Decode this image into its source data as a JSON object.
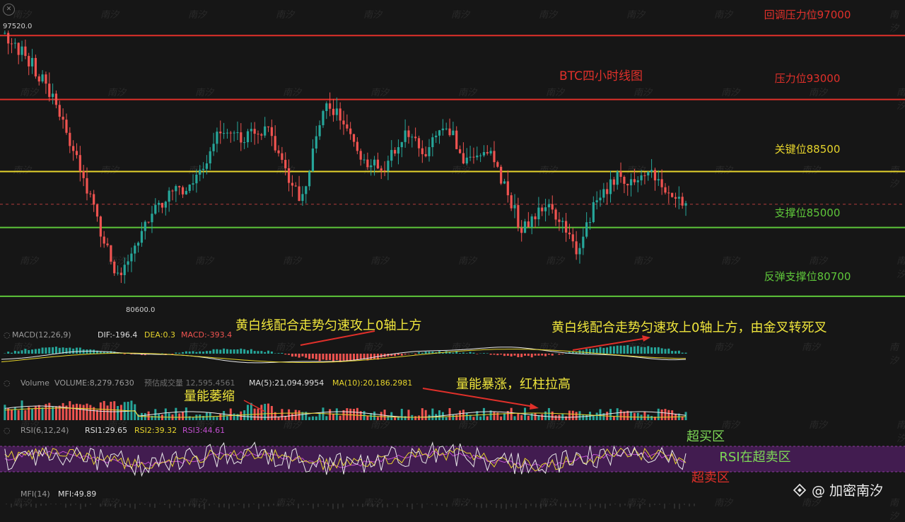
{
  "chart_data": [
    {
      "type": "candlestick",
      "title": "BTC四小时线图",
      "ylim": [
        79500,
        98600
      ],
      "high_marker": "97520.0",
      "low_marker": "80600.0",
      "last_price": 86450,
      "levels": [
        {
          "label": "回调压力位97000",
          "value": 97000,
          "color": "#e0302a"
        },
        {
          "label": "压力位93000",
          "value": 93000,
          "color": "#e0302a"
        },
        {
          "label": "关键位88500",
          "value": 88500,
          "color": "#e6d42c"
        },
        {
          "label": "支撑位85000",
          "value": 85000,
          "color": "#5ec63a"
        },
        {
          "label": "反弹支撑位80700",
          "value": 80700,
          "color": "#5ec63a"
        }
      ],
      "anchors": [
        [
          0,
          97200
        ],
        [
          8,
          95500
        ],
        [
          14,
          93600
        ],
        [
          22,
          89500
        ],
        [
          30,
          84200
        ],
        [
          34,
          81800
        ],
        [
          40,
          84200
        ],
        [
          46,
          86500
        ],
        [
          52,
          87300
        ],
        [
          58,
          88200
        ],
        [
          64,
          91200
        ],
        [
          70,
          90600
        ],
        [
          78,
          91000
        ],
        [
          84,
          88200
        ],
        [
          88,
          86700
        ],
        [
          94,
          92700
        ],
        [
          100,
          91800
        ],
        [
          106,
          89200
        ],
        [
          112,
          88600
        ],
        [
          118,
          91100
        ],
        [
          124,
          89800
        ],
        [
          130,
          91600
        ],
        [
          136,
          89000
        ],
        [
          142,
          89900
        ],
        [
          148,
          87200
        ],
        [
          152,
          84800
        ],
        [
          158,
          86400
        ],
        [
          164,
          85400
        ],
        [
          168,
          83300
        ],
        [
          174,
          86700
        ],
        [
          180,
          88100
        ],
        [
          186,
          87700
        ],
        [
          190,
          88500
        ],
        [
          194,
          87300
        ],
        [
          200,
          86500
        ]
      ],
      "annotations": [],
      "colors": {
        "up": "#26a69a",
        "down": "#ef5350"
      }
    },
    {
      "type": "line",
      "indicator": "MACD",
      "params": "MACD(12,26,9)",
      "dif_label": "DIF:-196.4",
      "dea_label": "DEA:0.3",
      "macd_label": "MACD:-393.4",
      "annotation_left": "黄白线配合走势匀速攻上0轴上方",
      "annotation_right": "黄白线配合走势匀速攻上0轴上方，由金叉转死叉"
    },
    {
      "type": "bar",
      "indicator": "Volume",
      "volume_label": "VOLUME:8,279.7630",
      "estimate_label": "预估成交量 12,595.4561",
      "ma5_label": "MA(5):21,094.9954",
      "ma10_label": "MA(10):20,186.2981",
      "annotation_shrink": "量能萎缩",
      "annotation_surge": "量能暴涨，红柱拉高"
    },
    {
      "type": "line",
      "indicator": "RSI",
      "params": "RSI(6,12,24)",
      "rsi1_label": "RSI1:29.65",
      "rsi2_label": "RSI2:39.32",
      "rsi3_label": "RSI3:44.61",
      "overbought_label": "超买区",
      "oversold_label": "超卖区",
      "note": "RSI在超卖区"
    },
    {
      "type": "line",
      "indicator": "MFI",
      "params": "MFI(14)",
      "mfi_label": "MFI:49.89"
    }
  ],
  "watermark": "南汐",
  "brand": {
    "icon": "diamond-logo-icon",
    "text": "@ 加密南汐"
  }
}
